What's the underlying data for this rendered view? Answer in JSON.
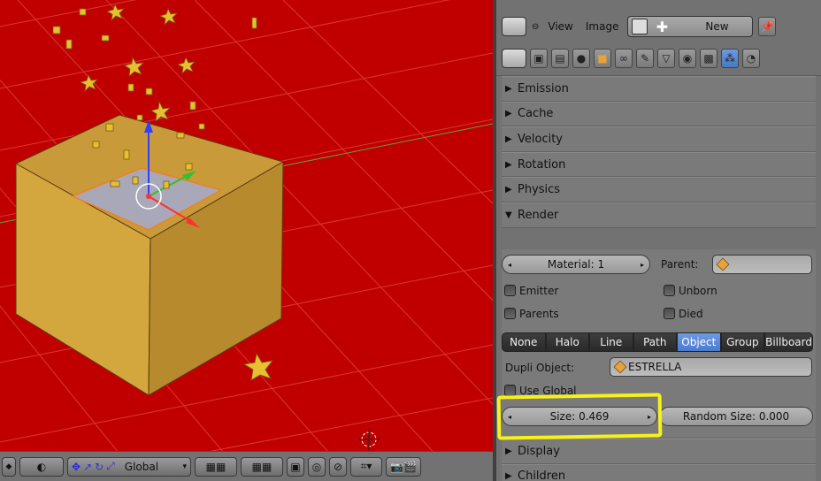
{
  "viewport": {
    "header": {
      "orientation": "Global",
      "mode_icon": "object-mode-icon"
    },
    "colors": {
      "background": "#c00000",
      "cube": "#d4a63e",
      "stars": "#e0c040"
    }
  },
  "properties": {
    "header": {
      "menu_view": "View",
      "menu_image": "Image",
      "new_label": "New"
    },
    "context_icons": [
      "render-icon",
      "render-layers-icon",
      "world-icon",
      "object-icon",
      "constraints-icon",
      "modifiers-icon",
      "data-icon",
      "material-icon",
      "texture-icon",
      "particles-icon",
      "physics-icon"
    ],
    "panels_collapsed": [
      "Emission",
      "Cache",
      "Velocity",
      "Rotation",
      "Physics"
    ],
    "render_panel": {
      "title": "Render",
      "material_label": "Material: 1",
      "parent_label": "Parent:",
      "checkboxes": {
        "emitter": "Emitter",
        "unborn": "Unborn",
        "parents": "Parents",
        "died": "Died",
        "use_global": "Use Global"
      },
      "render_types": [
        "None",
        "Halo",
        "Line",
        "Path",
        "Object",
        "Group",
        "Billboard"
      ],
      "selected_type": "Object",
      "dupli_object_label": "Dupli Object:",
      "dupli_object_value": "ESTRELLA",
      "size_label": "Size: 0.469",
      "random_size_label": "Random Size: 0.000"
    },
    "panels_after": [
      "Display",
      "Children"
    ],
    "highlight_color": "#f7f11a",
    "accent": "#5a8ad8"
  }
}
